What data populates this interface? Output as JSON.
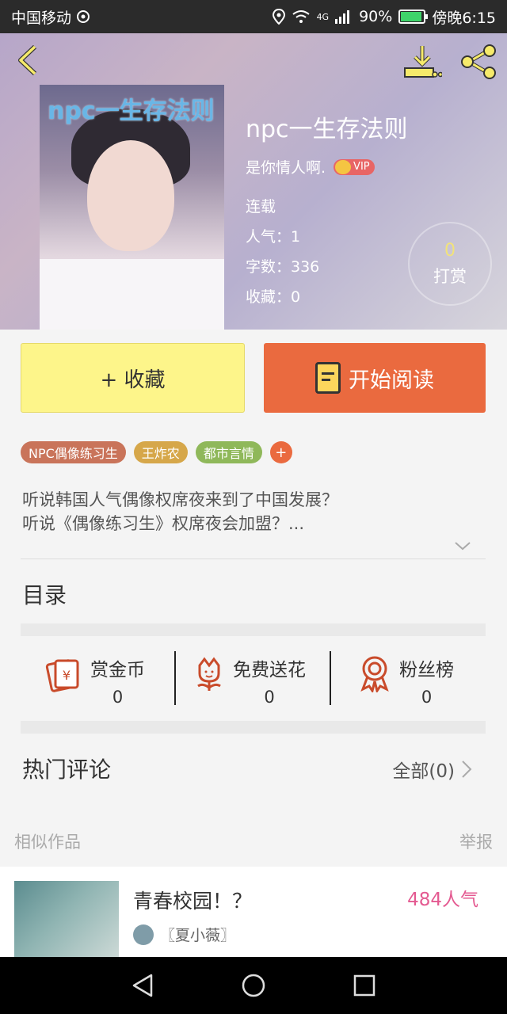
{
  "status": {
    "carrier": "中国移动",
    "battery": "90%",
    "time": "傍晚6:15",
    "network": "4G",
    "battery_level": 0.9
  },
  "book": {
    "cover_text": "npc一生存法则",
    "title": "npc一生存法则",
    "author": "是你情人啊.",
    "vip_label": "VIP",
    "status": "连载",
    "popularity": "人气：1",
    "word_count": "字数：336",
    "favorites": "收藏：0",
    "tip_count": "0",
    "tip_label": "打赏"
  },
  "actions": {
    "favorite": "+ 收藏",
    "read": "开始阅读"
  },
  "tags": [
    {
      "label": "NPC偶像练习生",
      "color": "#c9745a"
    },
    {
      "label": "王炸农",
      "color": "#d6a74a"
    },
    {
      "label": "都市言情",
      "color": "#8fb85a"
    }
  ],
  "tag_add": "+",
  "description": {
    "line1": "听说韩国人气偶像权席夜来到了中国发展？",
    "line2": "听说《偶像练习生》权席夜会加盟？..."
  },
  "toc_title": "目录",
  "rewards": [
    {
      "label": "赏金币",
      "value": "0",
      "icon": "money-envelope-icon"
    },
    {
      "label": "免费送花",
      "value": "0",
      "icon": "flower-icon"
    },
    {
      "label": "粉丝榜",
      "value": "0",
      "icon": "medal-icon"
    }
  ],
  "comments": {
    "title": "热门评论",
    "all_link": "全部(0)"
  },
  "similar_section": {
    "title": "相似作品",
    "report": "举报"
  },
  "similar_item": {
    "title": "青春校园！？",
    "popularity": "484人气",
    "author": "〖夏小薇〗"
  }
}
